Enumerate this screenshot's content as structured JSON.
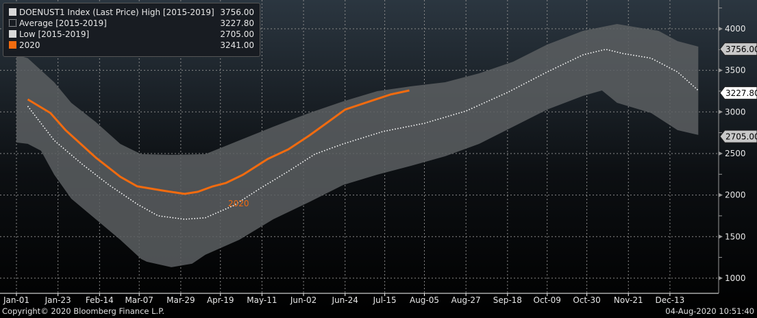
{
  "chart_data": {
    "type": "area",
    "title": "DOENUST1 Index (Last Price)",
    "xlabel": "",
    "ylabel": "",
    "ylim": [
      850,
      4300
    ],
    "xlim_days": [
      0,
      365
    ],
    "y_ticks": [
      1000,
      1500,
      2000,
      2500,
      3000,
      3500,
      4000
    ],
    "x_ticks": [
      {
        "label": "Jan-01",
        "day": 0
      },
      {
        "label": "Jan-23",
        "day": 22
      },
      {
        "label": "Feb-14",
        "day": 44
      },
      {
        "label": "Mar-07",
        "day": 65
      },
      {
        "label": "Mar-29",
        "day": 87
      },
      {
        "label": "Apr-19",
        "day": 108
      },
      {
        "label": "May-11",
        "day": 130
      },
      {
        "label": "Jun-02",
        "day": 152
      },
      {
        "label": "Jun-24",
        "day": 174
      },
      {
        "label": "Jul-15",
        "day": 195
      },
      {
        "label": "Aug-05",
        "day": 216
      },
      {
        "label": "Aug-27",
        "day": 238
      },
      {
        "label": "Sep-18",
        "day": 260
      },
      {
        "label": "Oct-09",
        "day": 281
      },
      {
        "label": "Oct-30",
        "day": 302
      },
      {
        "label": "Nov-21",
        "day": 324
      },
      {
        "label": "Dec-13",
        "day": 346
      }
    ],
    "grid": true,
    "legend_placement": "top-left",
    "series": [
      {
        "name": "DOENUST1 Index (Last Price) High [2015-2019]",
        "last": "3756.00",
        "color": "#d8d8d8",
        "x": [
          0,
          6,
          20,
          29,
          42,
          55,
          66,
          82,
          100,
          118,
          136,
          155,
          173,
          191,
          209,
          227,
          245,
          263,
          281,
          300,
          318,
          329,
          340,
          350,
          361
        ],
        "y": [
          3687,
          3646,
          3357,
          3110,
          2879,
          2615,
          2492,
          2484,
          2492,
          2657,
          2822,
          2987,
          3127,
          3250,
          3308,
          3357,
          3464,
          3604,
          3810,
          3975,
          4058,
          4016,
          3975,
          3852,
          3786
        ]
      },
      {
        "name": "Average [2015-2019]",
        "last": "3227.80",
        "color": "#ffffff",
        "x": [
          6,
          20,
          35,
          49,
          64,
          75,
          89,
          100,
          115,
          129,
          144,
          158,
          173,
          194,
          216,
          238,
          260,
          281,
          300,
          312,
          321,
          336,
          350,
          361
        ],
        "y": [
          3069,
          2657,
          2368,
          2121,
          1890,
          1750,
          1709,
          1726,
          1874,
          2080,
          2286,
          2492,
          2616,
          2764,
          2863,
          3011,
          3234,
          3481,
          3687,
          3753,
          3703,
          3646,
          3481,
          3258
        ]
      },
      {
        "name": "Low [2015-2019]",
        "last": "2705.00",
        "color": "#d8d8d8",
        "x": [
          0,
          6,
          13,
          20,
          29,
          42,
          55,
          66,
          69,
          82,
          93,
          100,
          118,
          136,
          155,
          173,
          191,
          209,
          227,
          245,
          263,
          281,
          300,
          310,
          318,
          336,
          350,
          361
        ],
        "y": [
          2632,
          2616,
          2533,
          2245,
          1956,
          1709,
          1462,
          1231,
          1198,
          1132,
          1174,
          1281,
          1462,
          1709,
          1915,
          2121,
          2245,
          2352,
          2467,
          2616,
          2822,
          3028,
          3193,
          3258,
          3110,
          2987,
          2781,
          2723
        ]
      },
      {
        "name": "2020",
        "last": "3241.00",
        "color": "#f26b0f",
        "x": [
          6,
          18,
          26,
          42,
          55,
          64,
          77,
          89,
          96,
          104,
          111,
          120,
          133,
          144,
          155,
          165,
          174,
          187,
          198,
          208
        ],
        "y": [
          3151,
          2987,
          2781,
          2451,
          2220,
          2105,
          2055,
          2014,
          2039,
          2105,
          2146,
          2245,
          2434,
          2550,
          2715,
          2879,
          3028,
          3127,
          3209,
          3258
        ]
      }
    ],
    "annotations": [
      "2020"
    ],
    "price_tags": [
      {
        "label": "3756.00",
        "value": 3756,
        "style": "gray"
      },
      {
        "label": "3227.80",
        "value": 3227.8,
        "style": "white"
      },
      {
        "label": "2705.00",
        "value": 2705,
        "style": "gray"
      }
    ]
  },
  "legend": [
    {
      "label": "DOENUST1 Index (Last Price) High [2015-2019]",
      "value": "3756.00"
    },
    {
      "label": "Average [2015-2019]",
      "value": "3227.80"
    },
    {
      "label": "Low [2015-2019]",
      "value": "2705.00"
    },
    {
      "label": "2020",
      "value": "3241.00"
    }
  ],
  "footer": {
    "copyright": "Copyright© 2020 Bloomberg Finance L.P.",
    "timestamp": "04-Aug-2020 10:51:40"
  }
}
